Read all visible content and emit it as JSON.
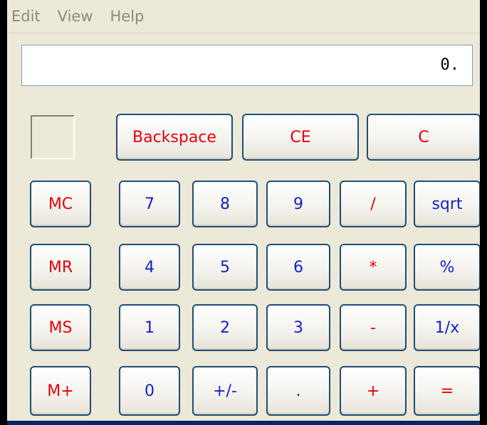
{
  "menu": {
    "edit": "Edit",
    "view": "View",
    "help": "Help"
  },
  "display": {
    "value": "0."
  },
  "buttons": {
    "backspace": "Backspace",
    "ce": "CE",
    "c": "C",
    "mc": "MC",
    "mr": "MR",
    "ms": "MS",
    "mplus": "M+",
    "d7": "7",
    "d8": "8",
    "d9": "9",
    "divide": "/",
    "sqrt": "sqrt",
    "d4": "4",
    "d5": "5",
    "d6": "6",
    "multiply": "*",
    "percent": "%",
    "d1": "1",
    "d2": "2",
    "d3": "3",
    "subtract": "-",
    "reciprocal": "1/x",
    "d0": "0",
    "negate": "+/-",
    "decimal": ".",
    "add": "+",
    "equals": "="
  },
  "colors": {
    "operator_text": "#e8000a",
    "digit_text": "#1520c8",
    "window_bg": "#ece9d8",
    "button_border": "#1e4d78"
  }
}
